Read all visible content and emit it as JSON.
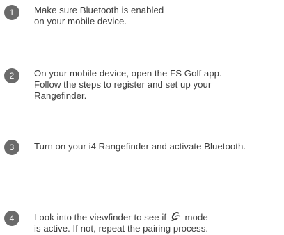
{
  "steps": [
    {
      "number": "1",
      "lines": [
        "Make sure Bluetooth is enabled",
        "on your mobile device."
      ]
    },
    {
      "number": "2",
      "lines": [
        "On your mobile device, open the FS Golf app.",
        "Follow the steps to register and set up your",
        "Rangefinder."
      ]
    },
    {
      "number": "3",
      "lines": [
        "Turn on your i4 Rangefinder and activate Bluetooth."
      ]
    },
    {
      "number": "4",
      "line1_before_icon": "Look into the viewfinder to see if",
      "line1_after_icon": "mode",
      "icon": "script-c-mode-icon",
      "lines": [
        "is active. If not, repeat the pairing process."
      ]
    }
  ]
}
